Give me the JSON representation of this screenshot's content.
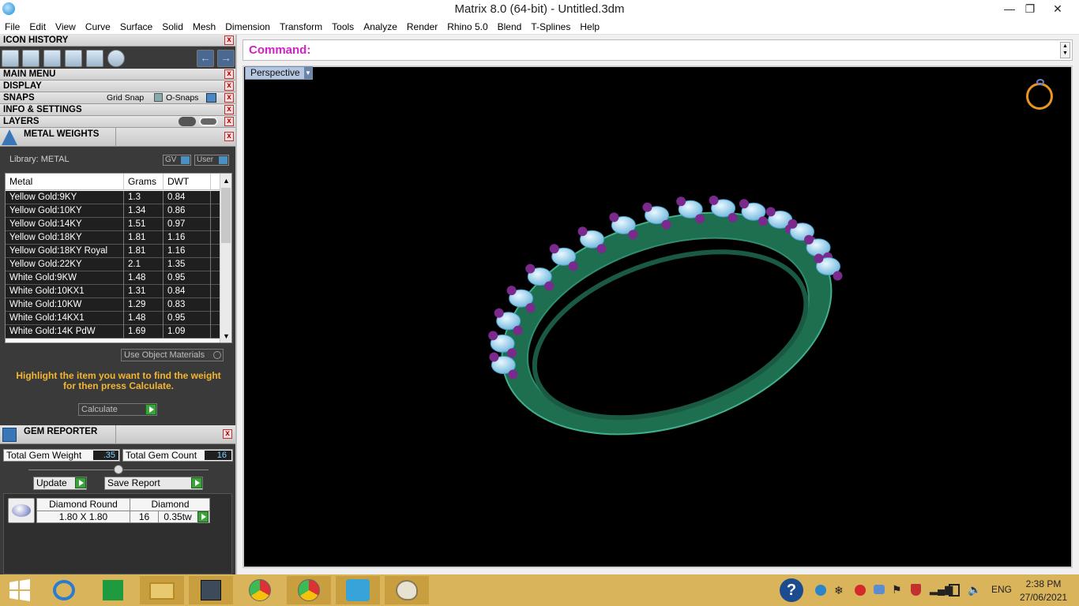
{
  "window": {
    "title": "Matrix 8.0 (64-bit) - Untitled.3dm",
    "minimize": "—",
    "restore": "❐",
    "close": "✕"
  },
  "menu": [
    "File",
    "Edit",
    "View",
    "Curve",
    "Surface",
    "Solid",
    "Mesh",
    "Dimension",
    "Transform",
    "Tools",
    "Analyze",
    "Render",
    "Rhino 5.0",
    "Blend",
    "T-Splines",
    "Help"
  ],
  "panels": {
    "icon_history": "ICON HISTORY",
    "main_menu": "MAIN MENU",
    "display": "DISPLAY",
    "snaps": "SNAPS",
    "grid_snap": "Grid Snap",
    "o_snaps": "O-Snaps",
    "info_settings": "INFO & SETTINGS",
    "layers": "LAYERS",
    "close_glyph": "x"
  },
  "metal_weights": {
    "title": "METAL WEIGHTS",
    "library": "Library: METAL",
    "gv": "GV",
    "user": "User",
    "columns": [
      "Metal",
      "Grams",
      "DWT"
    ],
    "rows": [
      [
        "Yellow Gold:9KY",
        "1.3",
        "0.84"
      ],
      [
        "Yellow Gold:10KY",
        "1.34",
        "0.86"
      ],
      [
        "Yellow Gold:14KY",
        "1.51",
        "0.97"
      ],
      [
        "Yellow Gold:18KY",
        "1.81",
        "1.16"
      ],
      [
        "Yellow Gold:18KY Royal",
        "1.81",
        "1.16"
      ],
      [
        "Yellow Gold:22KY",
        "2.1",
        "1.35"
      ],
      [
        "White Gold:9KW",
        "1.48",
        "0.95"
      ],
      [
        "White Gold:10KX1",
        "1.31",
        "0.84"
      ],
      [
        "White Gold:10KW",
        "1.29",
        "0.83"
      ],
      [
        "White Gold:14KX1",
        "1.48",
        "0.95"
      ],
      [
        "White Gold:14K PdW",
        "1.69",
        "1.09"
      ]
    ],
    "use_object_materials": "Use Object Materials",
    "hint": "Highlight the item you want to find the weight for then press Calculate.",
    "calculate": "Calculate"
  },
  "gem_reporter": {
    "title": "GEM REPORTER",
    "total_weight_label": "Total Gem Weight",
    "total_weight_value": ".35",
    "total_count_label": "Total Gem Count",
    "total_count_value": "16",
    "update": "Update",
    "save_report": "Save Report",
    "gem_shape": "Diamond Round",
    "gem_type": "Diamond",
    "gem_size": "1.80 X 1.80",
    "gem_count": "16",
    "gem_weight": "0.35tw"
  },
  "command": {
    "label": "Command:"
  },
  "viewport": {
    "name": "Perspective"
  },
  "taskbar": {
    "time": "2:38 PM",
    "date": "27/06/2021",
    "lang": "ENG",
    "colors": {
      "accent": "#d9b45a",
      "active": "#c89e3e"
    }
  },
  "colors": {
    "panel_bg": "#3a3a3a",
    "command_label": "#d021c8",
    "hint_text": "#f2b631",
    "ring_band": "#1e6e50",
    "gem": "#a4d8f0",
    "prong": "#7a2a8c"
  }
}
